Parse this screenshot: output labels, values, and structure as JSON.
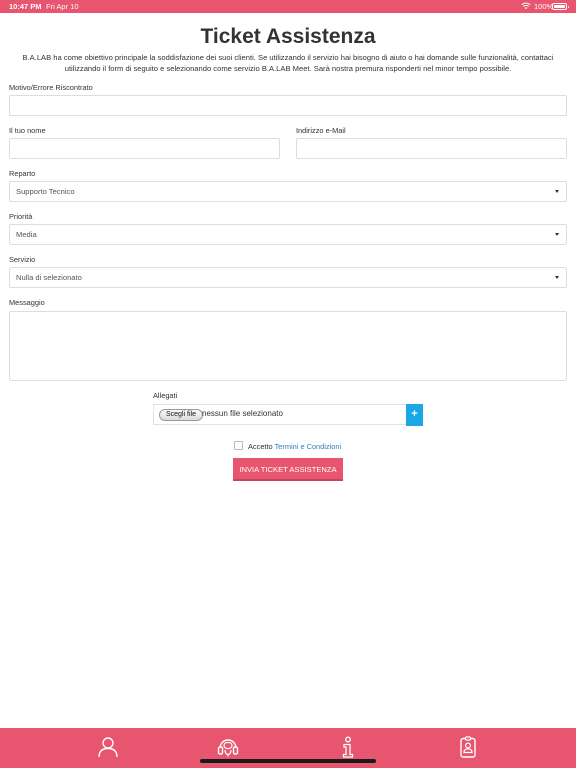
{
  "status": {
    "time": "10:47 PM",
    "date": "Fri Apr 10",
    "battery": "100%",
    "wifi_icon": "wifi-icon"
  },
  "page": {
    "title": "Ticket Assistenza",
    "intro_line1": "B.A.LAB ha come obiettivo principale la soddisfazione dei suoi clienti. Se utilizzando il servizio hai bisogno di aiuto o hai domande sulle funzionalità, contattaci",
    "intro_line2": "utilizzando il form di seguito e selezionando come servizio B.A.LAB Meet. Sarà nostra premura risponderti nel minor tempo possibile."
  },
  "form": {
    "motivo_label": "Motivo/Errore Riscontrato",
    "motivo_value": "",
    "nome_label": "Il tuo nome",
    "nome_value": "",
    "email_label": "Indirizzo e-Mail",
    "email_value": "",
    "reparto_label": "Reparto",
    "reparto_value": "Supporto Tecnico",
    "priorita_label": "Priorità",
    "priorita_value": "Media",
    "servizio_label": "Servizio",
    "servizio_value": "Nulla di selezionato",
    "messaggio_label": "Messaggio",
    "messaggio_value": "",
    "allegati_label": "Allegati",
    "file_button": "Scegli file",
    "file_status": "nessun file selezionato",
    "plus": "+",
    "accept_prefix": "Accetto",
    "accept_link": "Termini e Condizioni",
    "accept_checked": false,
    "submit": "INVIA TICKET ASSISTENZA"
  },
  "tabs": [
    {
      "icon": "person-icon"
    },
    {
      "icon": "headset-support-icon"
    },
    {
      "icon": "info-icon"
    },
    {
      "icon": "id-badge-icon"
    }
  ],
  "colors": {
    "brand": "#e8556e",
    "accent": "#1aa7e8",
    "link": "#2f7fb8"
  }
}
